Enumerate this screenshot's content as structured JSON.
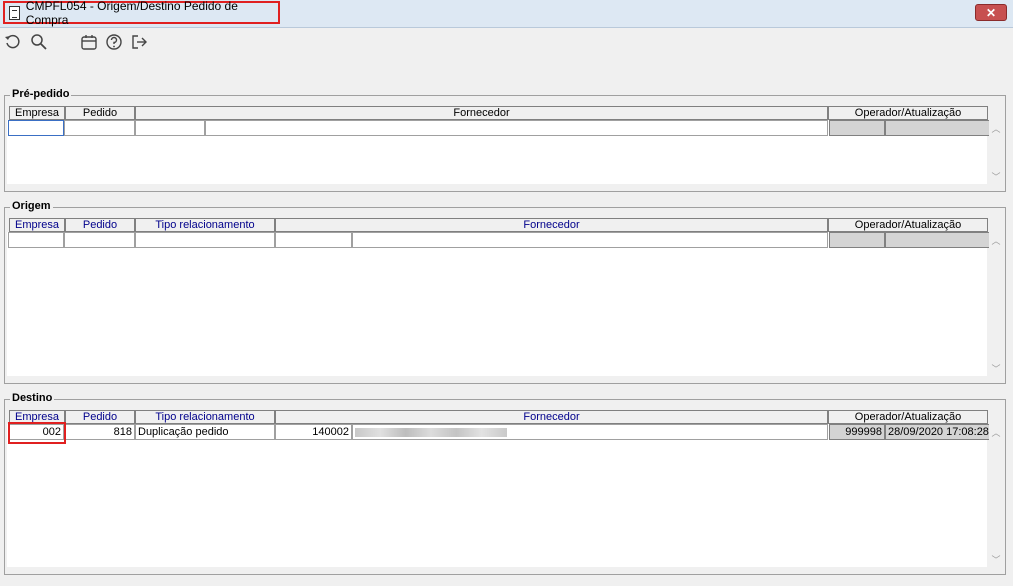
{
  "window": {
    "title": "CMPFL054 - Origem/Destino Pedido de Compra",
    "close_label": "✕"
  },
  "toolbar": {
    "icons": [
      "undo-icon",
      "search-icon",
      "calendar-icon",
      "help-icon",
      "exit-icon"
    ]
  },
  "pre_pedido": {
    "legend": "Pré-pedido",
    "headers": {
      "empresa": "Empresa",
      "pedido": "Pedido",
      "fornecedor": "Fornecedor",
      "operador": "Operador/Atualização"
    }
  },
  "origem": {
    "legend": "Origem",
    "headers": {
      "empresa": "Empresa",
      "pedido": "Pedido",
      "tipo": "Tipo relacionamento",
      "fornecedor": "Fornecedor",
      "operador": "Operador/Atualização"
    }
  },
  "destino": {
    "legend": "Destino",
    "headers": {
      "empresa": "Empresa",
      "pedido": "Pedido",
      "tipo": "Tipo relacionamento",
      "fornecedor": "Fornecedor",
      "operador": "Operador/Atualização"
    },
    "row": {
      "empresa": "002",
      "pedido": "818",
      "tipo": "Duplicação pedido",
      "fornecedor_codigo": "140002",
      "operador": "999998",
      "atualizacao": "28/09/2020 17:08:28"
    }
  },
  "colors": {
    "highlight": "#e02020",
    "header_blue": "#00008b"
  }
}
